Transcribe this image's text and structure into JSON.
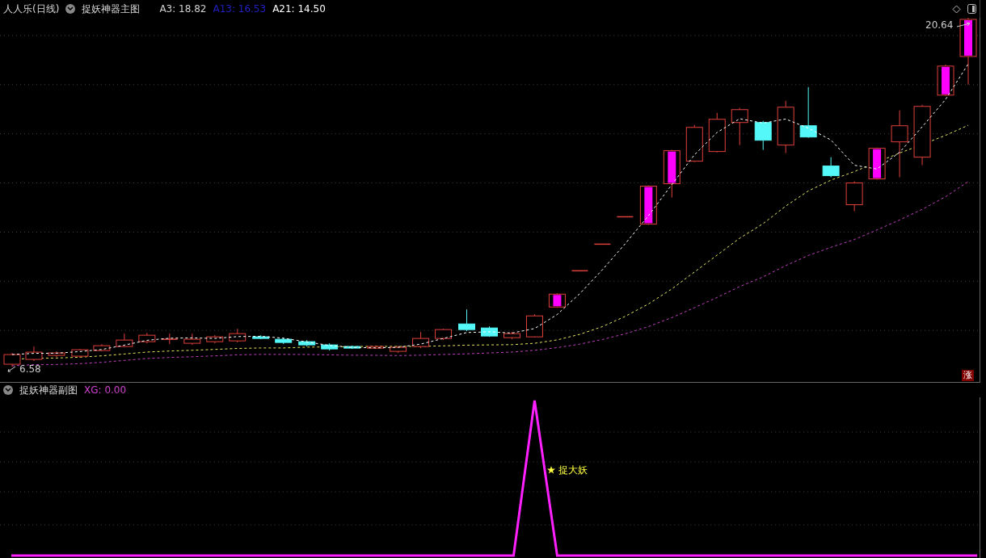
{
  "main_header": {
    "stock": "人人乐(日线)",
    "indicator": "捉妖神器主图",
    "values": [
      {
        "text": "A3: 18.82",
        "color": "#d0d0d0"
      },
      {
        "text": "A13: 16.53",
        "color": "#2020c0"
      },
      {
        "text": "A21: 14.50",
        "color": "#ffffff"
      }
    ]
  },
  "main_chart": {
    "low_label": "6.58",
    "high_label": "20.64",
    "badge": "涨"
  },
  "sub_header": {
    "indicator": "捉妖神器副图",
    "value": "XG: 0.00"
  },
  "sub_chart": {
    "signal_label": "捉大妖"
  }
}
